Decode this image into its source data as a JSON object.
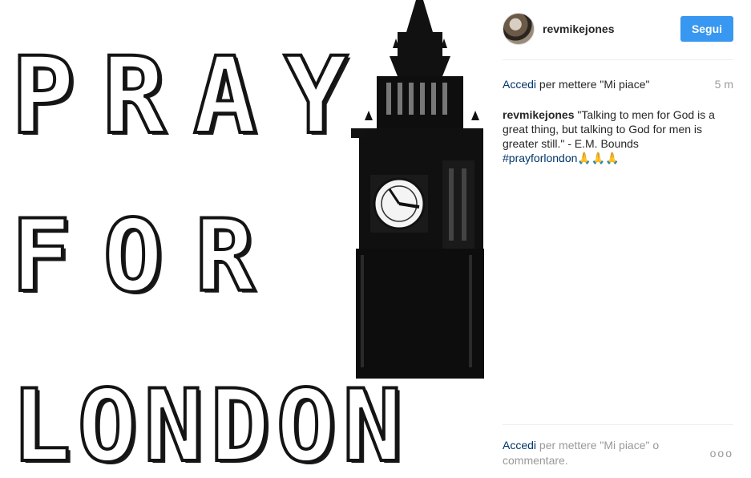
{
  "post": {
    "poster_lines": [
      "PRAY",
      "FOR",
      "LONDON"
    ]
  },
  "header": {
    "username": "revmikejones",
    "follow_label": "Segui"
  },
  "likes": {
    "link": "Accedi",
    "text": " per mettere \"Mi piace\"",
    "time": "5 m"
  },
  "caption": {
    "user": "revmikejones",
    "text": " \"Talking to men for God is a great thing, but talking to God for men is greater still.\" - E.M. Bounds ",
    "hashtag": "#prayforlondon",
    "emoji": "🙏🙏🙏"
  },
  "footer": {
    "link": "Accedi",
    "text": " per mettere \"Mi piace\" o commentare.",
    "more_icon": "more-options-icon",
    "more_label": "ooo"
  }
}
